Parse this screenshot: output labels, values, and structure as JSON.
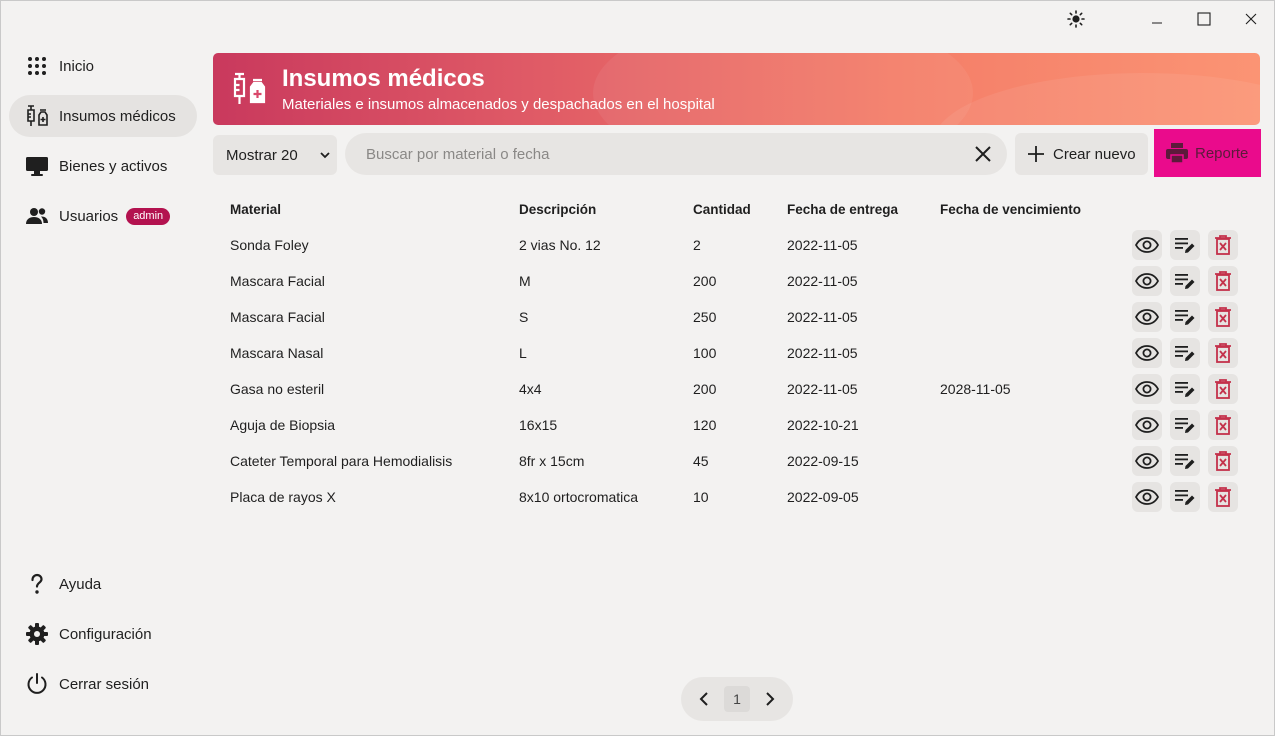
{
  "window": {
    "theme_icon": "sun-icon",
    "minimize_icon": "minimize-icon",
    "maximize_icon": "maximize-icon",
    "close_icon": "close-icon"
  },
  "sidebar": {
    "top_items": [
      {
        "label": "Inicio",
        "icon": "grid-dots-icon",
        "active": false
      },
      {
        "label": "Insumos médicos",
        "icon": "medical-supplies-icon",
        "active": true
      },
      {
        "label": "Bienes y activos",
        "icon": "monitor-icon",
        "active": false
      },
      {
        "label": "Usuarios",
        "icon": "users-icon",
        "active": false,
        "badge": "admin"
      }
    ],
    "bottom_items": [
      {
        "label": "Ayuda",
        "icon": "help-icon"
      },
      {
        "label": "Configuración",
        "icon": "gear-icon"
      },
      {
        "label": "Cerrar sesión",
        "icon": "power-icon"
      }
    ]
  },
  "header": {
    "title": "Insumos médicos",
    "subtitle": "Materiales e insumos almacenados y despachados en el hospital",
    "icon": "medical-supplies-icon"
  },
  "toolbar": {
    "page_size": "Mostrar 20",
    "search_placeholder": "Buscar por material o fecha",
    "search_value": "",
    "create_label": "Crear nuevo",
    "report_label": "Reporte"
  },
  "table": {
    "columns": [
      "Material",
      "Descripción",
      "Cantidad",
      "Fecha de entrega",
      "Fecha de vencimiento"
    ],
    "rows": [
      {
        "material": "Sonda Foley",
        "descripcion": "2 vias No. 12",
        "cantidad": "2",
        "entrega": "2022-11-05",
        "vencimiento": ""
      },
      {
        "material": "Mascara Facial",
        "descripcion": "M",
        "cantidad": "200",
        "entrega": "2022-11-05",
        "vencimiento": ""
      },
      {
        "material": "Mascara Facial",
        "descripcion": "S",
        "cantidad": "250",
        "entrega": "2022-11-05",
        "vencimiento": ""
      },
      {
        "material": "Mascara Nasal",
        "descripcion": "L",
        "cantidad": "100",
        "entrega": "2022-11-05",
        "vencimiento": ""
      },
      {
        "material": "Gasa no esteril",
        "descripcion": "4x4",
        "cantidad": "200",
        "entrega": "2022-11-05",
        "vencimiento": "2028-11-05"
      },
      {
        "material": "Aguja de Biopsia",
        "descripcion": "16x15",
        "cantidad": "120",
        "entrega": "2022-10-21",
        "vencimiento": ""
      },
      {
        "material": "Cateter Temporal para Hemodialisis",
        "descripcion": "8fr x 15cm",
        "cantidad": "45",
        "entrega": "2022-09-15",
        "vencimiento": ""
      },
      {
        "material": "Placa de rayos X",
        "descripcion": "8x10 ortocromatica",
        "cantidad": "10",
        "entrega": "2022-09-05",
        "vencimiento": ""
      }
    ]
  },
  "pagination": {
    "current_page": "1"
  },
  "colors": {
    "accent": "#ea0b8c",
    "badge": "#b3124f",
    "delete_icon": "#c4314b"
  }
}
